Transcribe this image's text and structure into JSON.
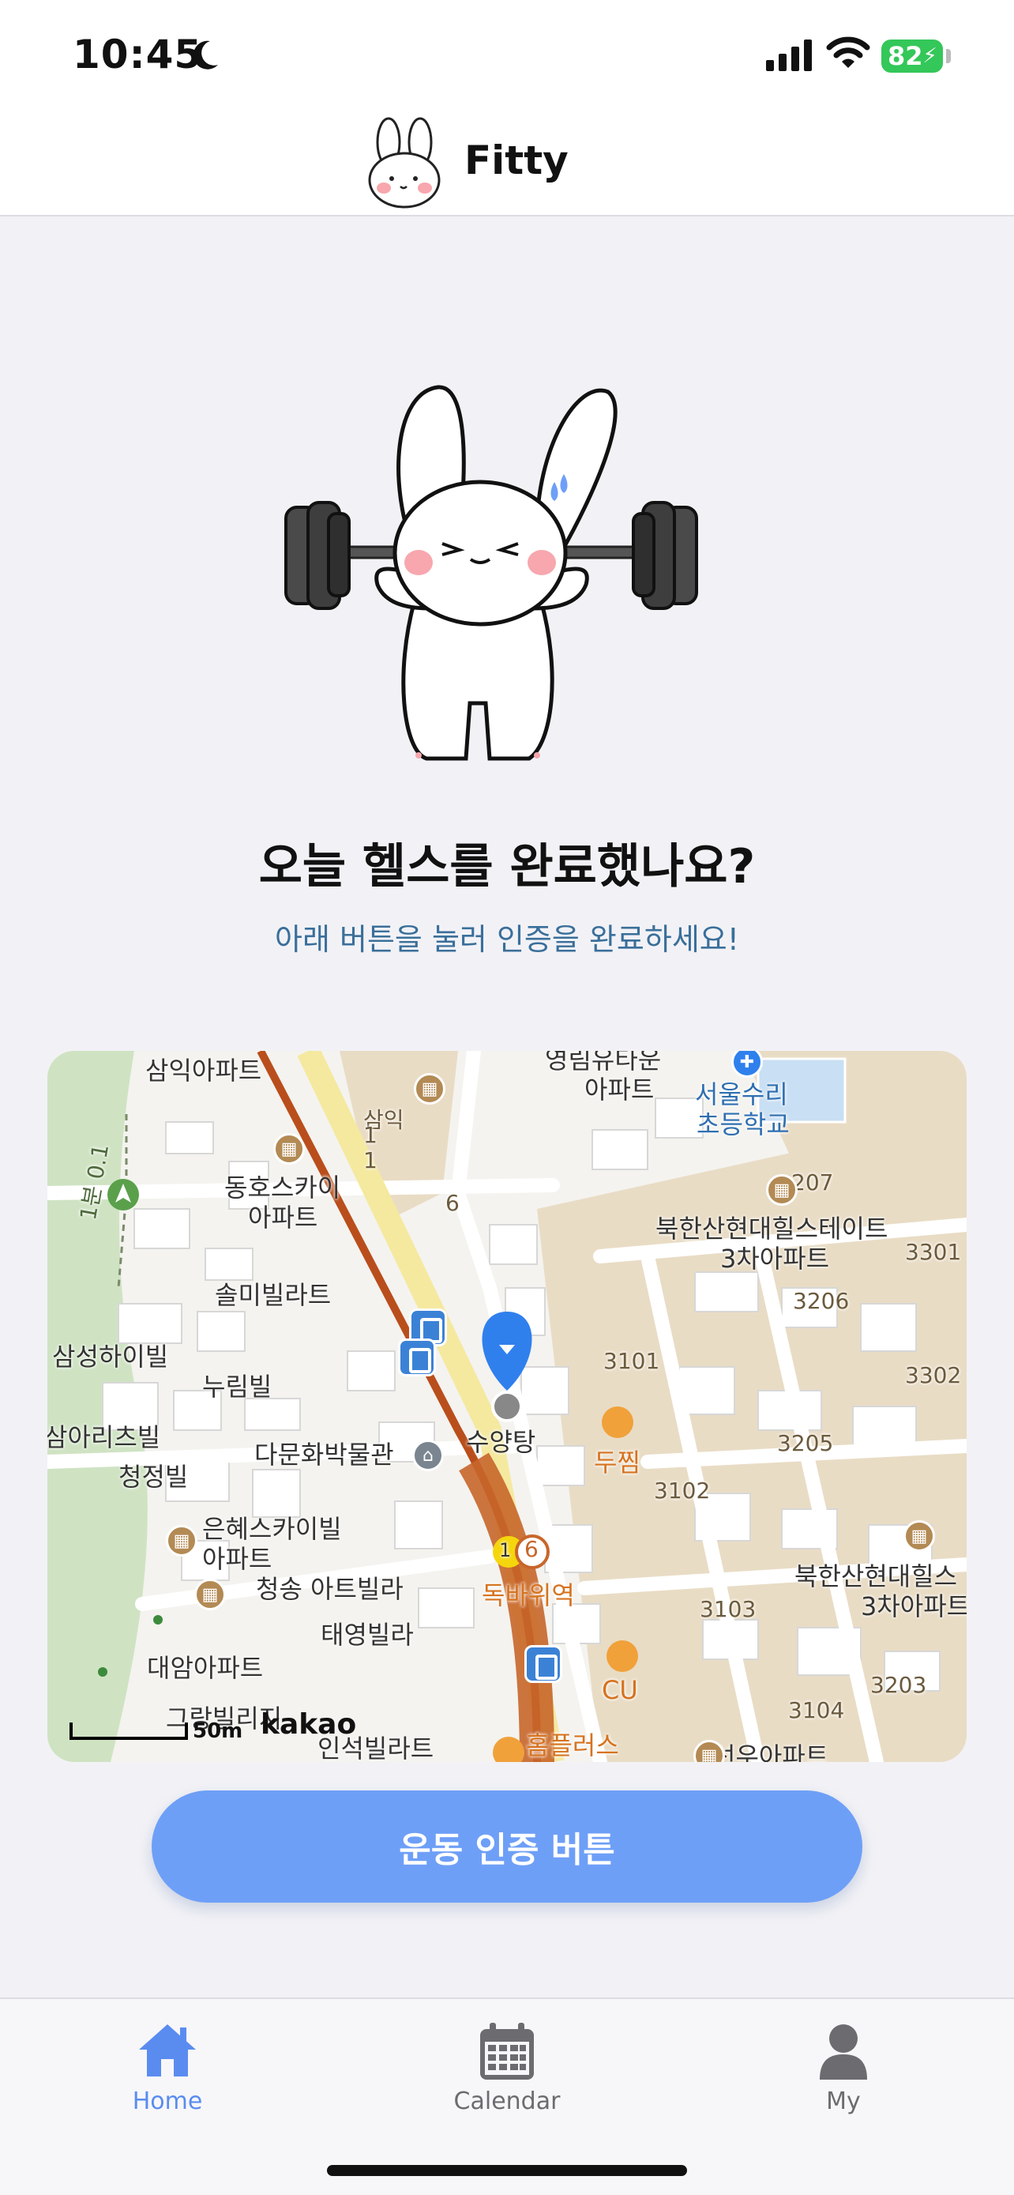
{
  "status_bar": {
    "time": "10:45",
    "battery_percent": "82",
    "icons": [
      "moon-icon",
      "signal-icon",
      "wifi-icon",
      "battery-icon"
    ]
  },
  "header": {
    "title": "Fitty",
    "logo_icon": "bunny-logo"
  },
  "hero": {
    "illustration": "bunny-lifting-barbell",
    "headline": "오늘 헬스를 완료했나요?",
    "subline": "아래 버튼을 눌러 인증을 완료하세요!"
  },
  "map": {
    "provider": "kakao",
    "scale": "50m",
    "current_location_label": "수양탕",
    "labels": [
      "삼익아파트",
      "삼익",
      "동호스카이",
      "아파트",
      "솔미빌라트",
      "삼성하이빌",
      "누림빌",
      "다문화박물관",
      "삼아리츠빌",
      "청정빌",
      "은혜스카이빌",
      "아파트",
      "청송 아트빌라",
      "태영빌라",
      "대암아파트",
      "그랑빌리지",
      "인석빌라트",
      "영림유타운",
      "아파트",
      "서울수리",
      "초등학교",
      "북한산현대힐스테이트",
      "3차아파트",
      "북한산현대힐스",
      "3차아파트",
      "두찜",
      "독바위역",
      "CU",
      "홈플러스",
      "선우아파트",
      "1",
      "6",
      "207",
      "3301",
      "3206",
      "3101",
      "3302",
      "3205",
      "3102",
      "3103",
      "3203",
      "3104",
      "1",
      "1분 0.1"
    ],
    "line_badges": [
      "1",
      "6"
    ]
  },
  "cta": {
    "label": "운동 인증 버튼"
  },
  "tab_bar": {
    "tabs": [
      {
        "label": "Home",
        "icon": "home-icon",
        "active": true
      },
      {
        "label": "Calendar",
        "icon": "calendar-icon",
        "active": false
      },
      {
        "label": "My",
        "icon": "user-icon",
        "active": false
      }
    ]
  },
  "colors": {
    "accent": "#6e9ff7",
    "tab_active": "#5a8cf0",
    "subtext": "#3a6f9a",
    "battery": "#34c759"
  }
}
